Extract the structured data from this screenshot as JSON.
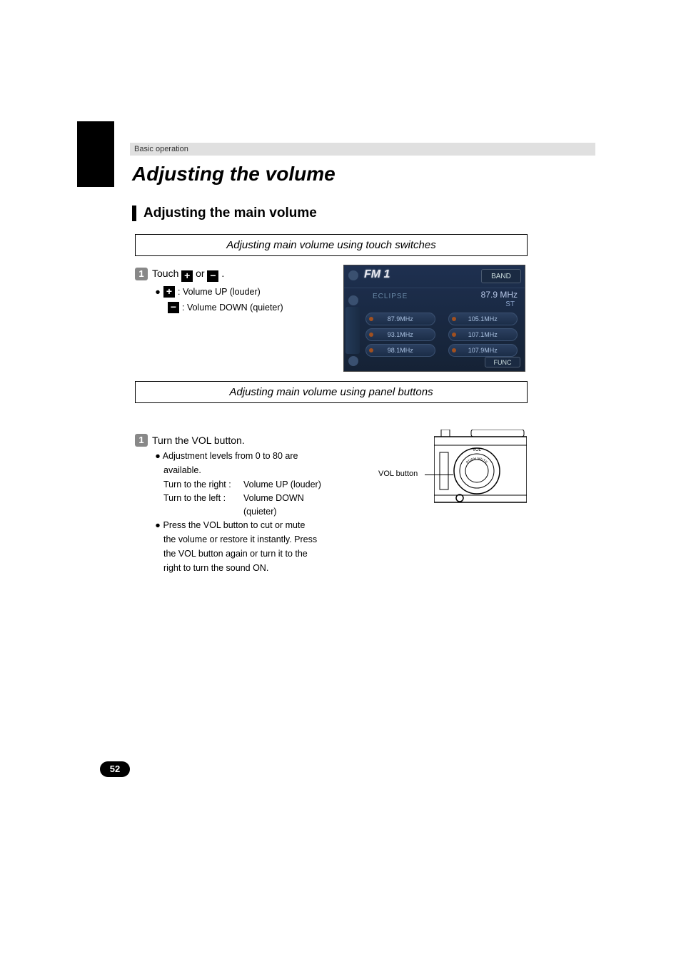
{
  "header": "Basic operation",
  "title": "Adjusting the volume",
  "section": "Adjusting the main volume",
  "subheading1": "Adjusting main volume using touch switches",
  "subheading2": "Adjusting main volume using panel buttons",
  "step1a": {
    "num": "1",
    "prefix": "Touch ",
    "middle": " or ",
    "suffix": " .",
    "plus_desc": " : Volume UP (louder)",
    "minus_desc": " : Volume DOWN (quieter)"
  },
  "step1b": {
    "num": "1",
    "text": "Turn the VOL button.",
    "b1a": "Adjustment levels from 0 to 80 are",
    "b1b": "available.",
    "right_label": "Turn to the right :",
    "right_desc": "Volume UP (louder)",
    "left_label": "Turn to the left :",
    "left_desc1": "Volume DOWN",
    "left_desc2": "(quieter)",
    "b2a": "Press the VOL button to cut or mute",
    "b2b": "the volume or restore it instantly. Press",
    "b2c": "the VOL button again or turn it to the",
    "b2d": "right to turn the sound ON."
  },
  "fm": {
    "title": "FM 1",
    "band": "BAND",
    "eclipse": "ECLIPSE",
    "freq": "87.9 MHz",
    "st": "ST",
    "presets": [
      "87.9MHz",
      "105.1MHz",
      "93.1MHz",
      "107.1MHz",
      "98.1MHz",
      "107.9MHz"
    ],
    "func": "FUNC"
  },
  "dial_label": "VOL button",
  "knob_label": "VOL",
  "knob_ring_text": "PUSH MUTE",
  "page_num": "52"
}
